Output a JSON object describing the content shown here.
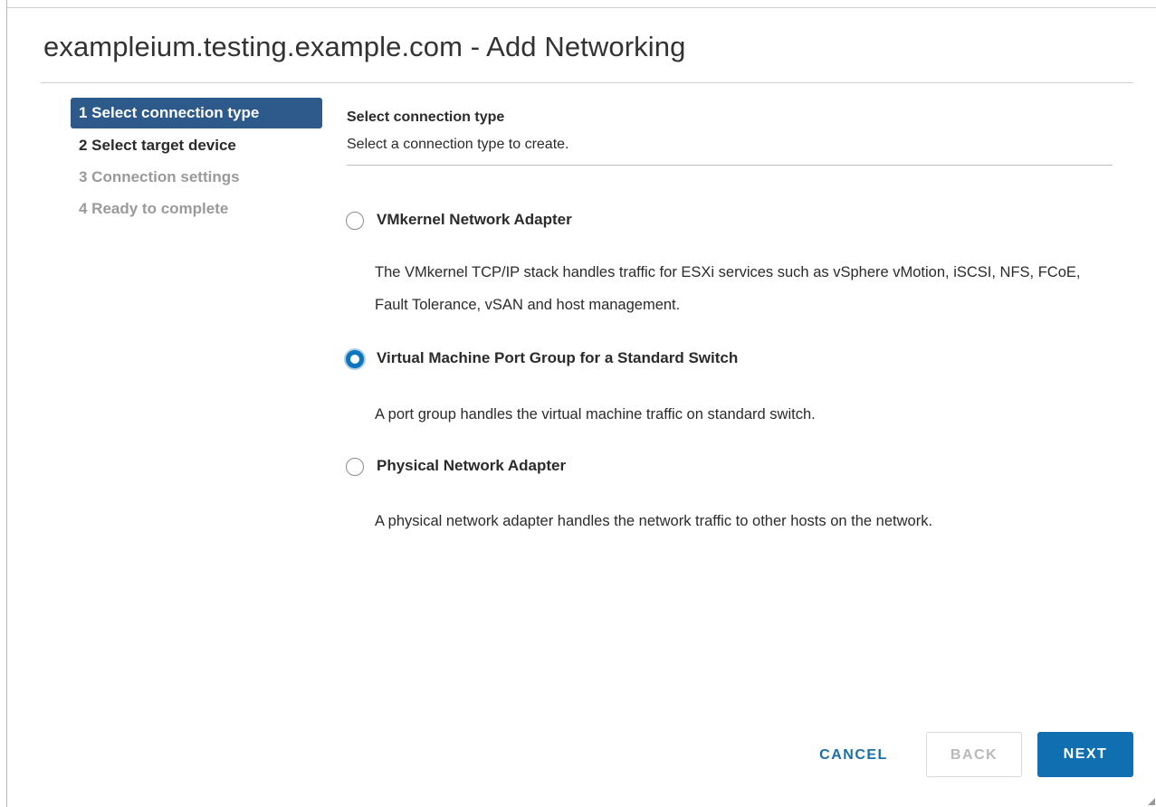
{
  "dialog": {
    "title": "exampleium.testing.example.com - Add Networking"
  },
  "steps": [
    {
      "label": "1 Select connection type",
      "state": "active"
    },
    {
      "label": "2 Select target device",
      "state": "enabled"
    },
    {
      "label": "3 Connection settings",
      "state": "disabled"
    },
    {
      "label": "4 Ready to complete",
      "state": "disabled"
    }
  ],
  "content": {
    "heading": "Select connection type",
    "subheading": "Select a connection type to create."
  },
  "options": [
    {
      "label": "VMkernel Network Adapter",
      "description": "The VMkernel TCP/IP stack handles traffic for ESXi services such as vSphere vMotion, iSCSI, NFS, FCoE, Fault Tolerance, vSAN and host management.",
      "selected": false
    },
    {
      "label": "Virtual Machine Port Group for a Standard Switch",
      "description": "A port group handles the virtual machine traffic on standard switch.",
      "selected": true
    },
    {
      "label": "Physical Network Adapter",
      "description": "A physical network adapter handles the network traffic to other hosts on the network.",
      "selected": false
    }
  ],
  "footer": {
    "cancel_label": "CANCEL",
    "back_label": "BACK",
    "next_label": "NEXT"
  },
  "colors": {
    "active_step_bg": "#2d5a8a",
    "primary_button": "#0f6fb0",
    "link_button": "#1b6fa8",
    "radio_selected": "#0f75bc"
  },
  "icons": {
    "resize_grip": "resize-grip-icon"
  }
}
